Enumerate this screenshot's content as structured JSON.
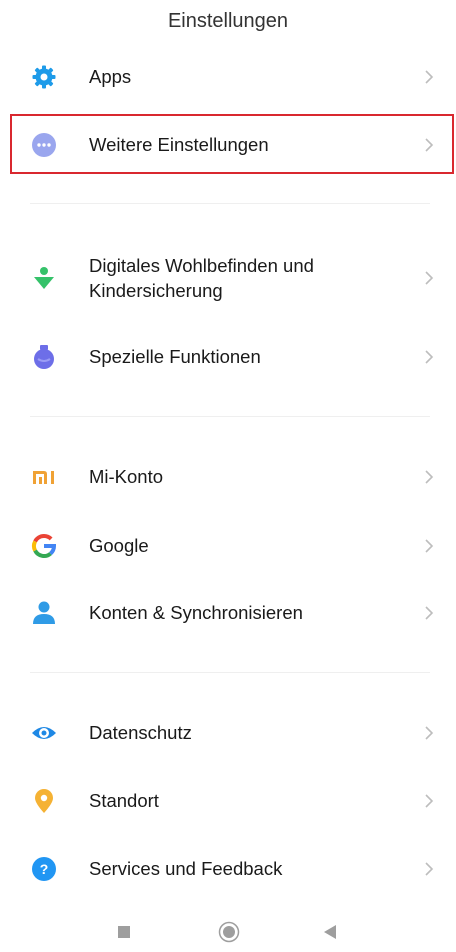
{
  "header": {
    "title": "Einstellungen"
  },
  "items": [
    {
      "id": "apps",
      "label": "Apps",
      "icon": "gear-icon",
      "color": "#1e9be9"
    },
    {
      "id": "weitere",
      "label": "Weitere Einstellungen",
      "icon": "more-dots-icon",
      "color": "#9aa6ee",
      "highlighted": true
    },
    {
      "id": "wohlbefinden",
      "label": "Digitales Wohlbefinden und Kindersicherung",
      "icon": "wellbeing-icon",
      "color": "#35c26a"
    },
    {
      "id": "spezielle",
      "label": "Spezielle Funktionen",
      "icon": "flask-icon",
      "color": "#6d6ee8"
    },
    {
      "id": "mikonto",
      "label": "Mi-Konto",
      "icon": "mi-logo-icon",
      "color": "#f0a235"
    },
    {
      "id": "google",
      "label": "Google",
      "icon": "google-g-icon",
      "color": "#4285f4"
    },
    {
      "id": "konten",
      "label": "Konten & Synchronisieren",
      "icon": "person-icon",
      "color": "#2f9be6"
    },
    {
      "id": "datenschutz",
      "label": "Datenschutz",
      "icon": "eye-icon",
      "color": "#1e88e5"
    },
    {
      "id": "standort",
      "label": "Standort",
      "icon": "location-pin-icon",
      "color": "#f5b234"
    },
    {
      "id": "services",
      "label": "Services und Feedback",
      "icon": "help-icon",
      "color": "#2196f3"
    }
  ],
  "navbar": {
    "recents_icon": "square-icon",
    "home_icon": "circle-home-icon",
    "back_icon": "triangle-back-icon"
  }
}
